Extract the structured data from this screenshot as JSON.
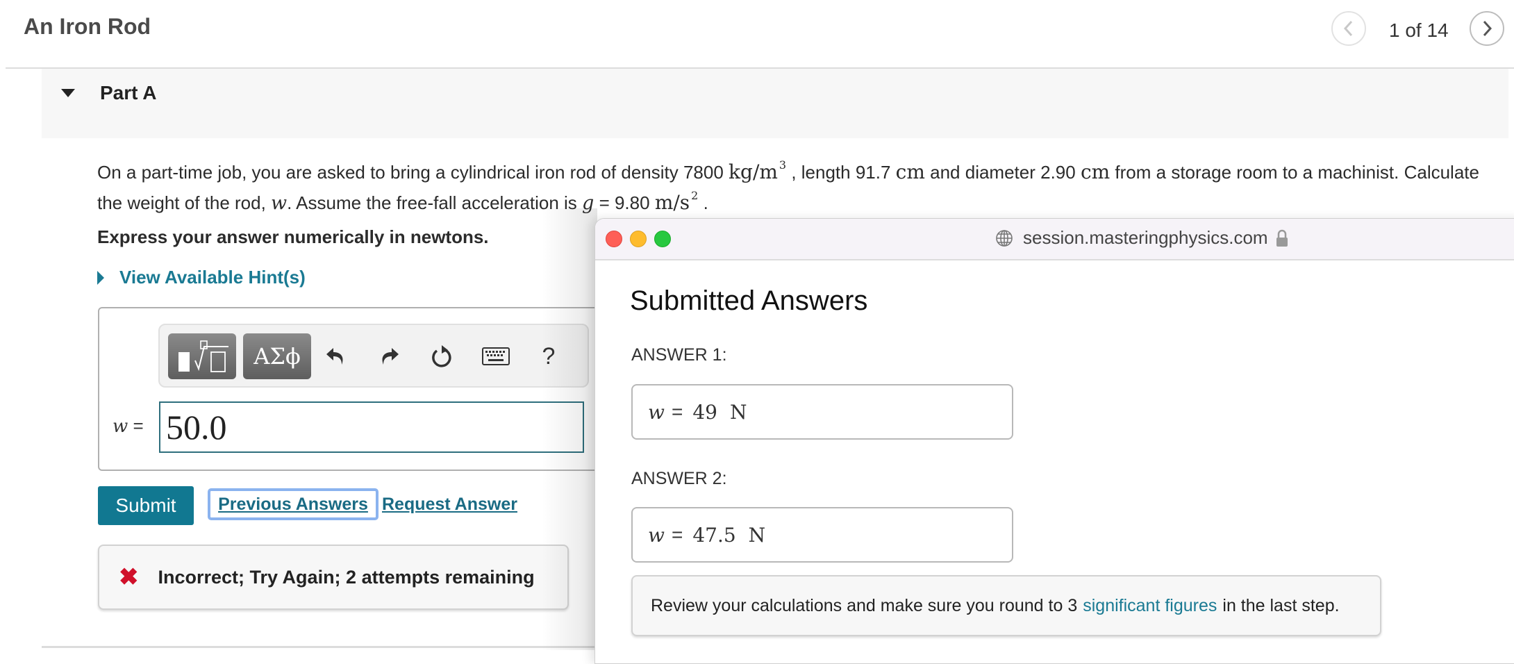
{
  "header": {
    "title": "An Iron Rod",
    "pagination": {
      "current": 1,
      "total": 14,
      "label": "1 of 14"
    },
    "prev_icon": "chevron-left-icon",
    "next_icon": "chevron-right-icon"
  },
  "part": {
    "title": "Part A",
    "expanded": true
  },
  "problem": {
    "t1": "On a part-time job, you are asked to bring a cylindrical iron rod of density 7800 ",
    "density_unit": "kg/m",
    "density_exp": "3",
    "t2": " , length 91.7 ",
    "length_unit": "cm",
    "t3": " and diameter 2.90 ",
    "diameter_unit": "cm",
    "t4": " from a storage room to a machinist. Calculate the weight of the rod, ",
    "var_w": "w",
    "t5": ". Assume the free-fall acceleration is ",
    "var_g": "g",
    "t6": " = 9.80 ",
    "g_unit": "m/s",
    "g_exp": "2",
    "t7": " ."
  },
  "instruction": "Express your answer numerically in newtons.",
  "hint_link": "View Available Hint(s)",
  "toolbar": {
    "templates_label": "templates",
    "greek_label": "ΑΣϕ",
    "help_label": "?"
  },
  "answer": {
    "var_label": "w",
    "equals": "=",
    "value": "50.0"
  },
  "actions": {
    "submit": "Submit",
    "previous_answers": "Previous Answers",
    "request_answer": "Request Answer"
  },
  "feedback": {
    "icon": "x-icon",
    "text": "Incorrect; Try Again; 2 attempts remaining",
    "color": "#d0102a"
  },
  "popup": {
    "url": "session.masteringphysics.com",
    "title": "Submitted Answers",
    "answers": [
      {
        "label": "ANSWER 1:",
        "var": "w",
        "value": "49",
        "unit": "N"
      },
      {
        "label": "ANSWER 2:",
        "var": "w",
        "value": "47.5",
        "unit": "N"
      }
    ],
    "tip": {
      "before": "Review your calculations and make sure you round to 3",
      "link": "significant figures",
      "after": "in the last step."
    }
  },
  "colors": {
    "accent": "#117891",
    "link": "#1a6b84",
    "error": "#d0102a"
  }
}
